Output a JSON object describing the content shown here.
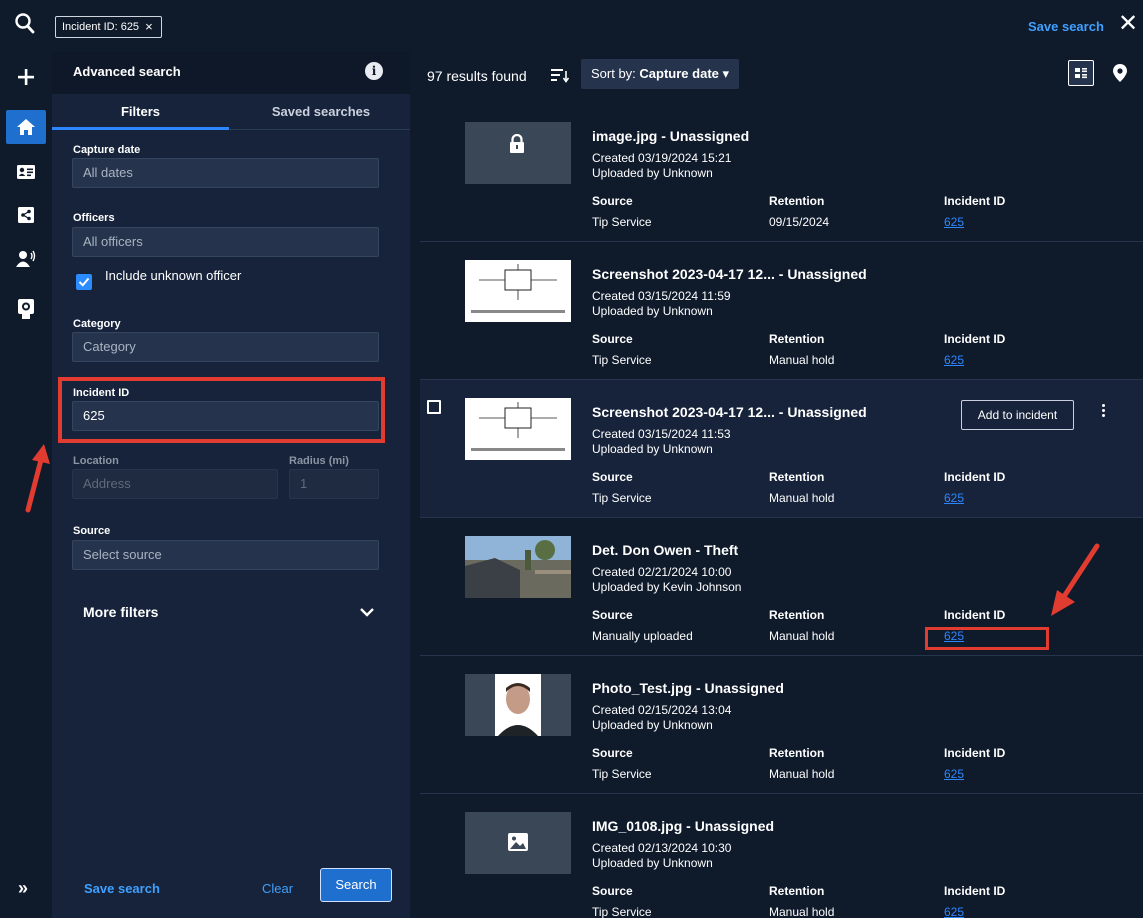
{
  "topbar": {
    "chip_label": "Incident ID: 625",
    "chip_close": "×",
    "save_search": "Save search",
    "close": "✕"
  },
  "rail": {
    "icons": [
      "search-icon",
      "add-icon",
      "home-icon",
      "id-card-icon",
      "share-icon",
      "user-audio-icon",
      "camera-icon"
    ],
    "expand": "»"
  },
  "panel": {
    "title": "Advanced search",
    "info": "i",
    "tabs": {
      "filters": "Filters",
      "saved": "Saved searches"
    },
    "capture_date": {
      "label": "Capture date",
      "value": "All dates"
    },
    "officers": {
      "label": "Officers",
      "value": "All officers"
    },
    "include_unknown": "Include unknown officer",
    "category": {
      "label": "Category",
      "placeholder": "Category"
    },
    "incident_id": {
      "label": "Incident ID",
      "value": "625"
    },
    "location": {
      "label": "Location",
      "placeholder": "Address"
    },
    "radius": {
      "label": "Radius (mi)",
      "placeholder": "1"
    },
    "source": {
      "label": "Source",
      "placeholder": "Select source"
    },
    "more_filters": "More filters",
    "footer": {
      "save": "Save search",
      "clear": "Clear",
      "search": "Search"
    }
  },
  "results": {
    "count": "97 results found",
    "sort_prefix": "Sort by:",
    "sort_value": "Capture date",
    "sort_caret": "▾",
    "column_labels": {
      "source": "Source",
      "retention": "Retention",
      "incident": "Incident ID"
    },
    "add_to_incident": "Add to incident",
    "items": [
      {
        "title": "image.jpg - Unassigned",
        "created": "Created 03/19/2024 15:21",
        "uploaded": "Uploaded by Unknown",
        "source": "Tip Service",
        "retention": "09/15/2024",
        "incident": "625",
        "thumb": "lock-icon"
      },
      {
        "title": "Screenshot 2023-04-17 12... - Unassigned",
        "created": "Created 03/15/2024 11:59",
        "uploaded": "Uploaded by Unknown",
        "source": "Tip Service",
        "retention": "Manual hold",
        "incident": "625",
        "thumb": "diagram-thumbnail"
      },
      {
        "title": "Screenshot 2023-04-17 12... - Unassigned",
        "created": "Created 03/15/2024 11:53",
        "uploaded": "Uploaded by Unknown",
        "source": "Tip Service",
        "retention": "Manual hold",
        "incident": "625",
        "thumb": "diagram-thumbnail"
      },
      {
        "title": "Det. Don Owen - Theft",
        "created": "Created 02/21/2024 10:00",
        "uploaded": "Uploaded by Kevin Johnson",
        "source": "Manually uploaded",
        "retention": "Manual hold",
        "incident": "625",
        "thumb": "car-photo-thumbnail"
      },
      {
        "title": "Photo_Test.jpg - Unassigned",
        "created": "Created 02/15/2024 13:04",
        "uploaded": "Uploaded by Unknown",
        "source": "Tip Service",
        "retention": "Manual hold",
        "incident": "625",
        "thumb": "portrait-thumbnail"
      },
      {
        "title": "IMG_0108.jpg - Unassigned",
        "created": "Created 02/13/2024 10:30",
        "uploaded": "Uploaded by Unknown",
        "source": "Tip Service",
        "retention": "Manual hold",
        "incident": "625",
        "thumb": "image-icon"
      }
    ]
  },
  "colors": {
    "accent": "#2e86ff",
    "annotation": "#e23b30",
    "panel": "#16233a",
    "background": "#0f1a2b"
  }
}
